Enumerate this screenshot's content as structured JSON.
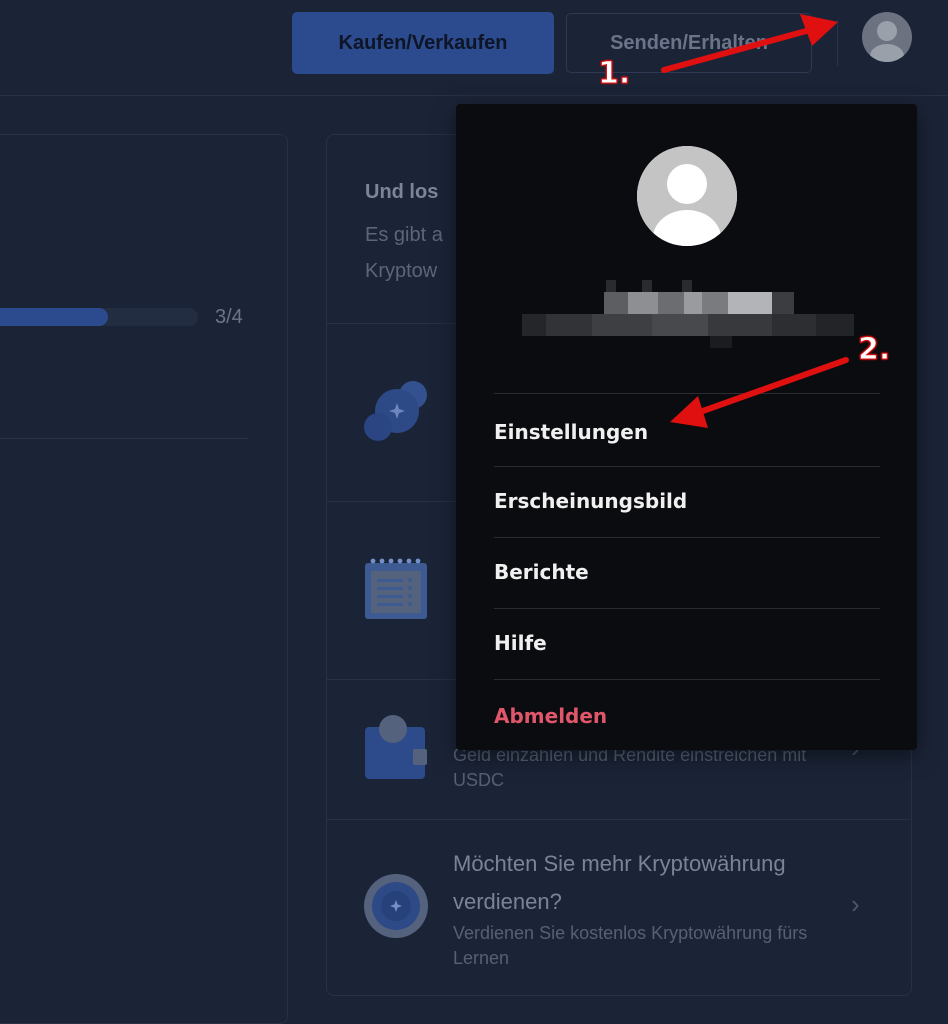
{
  "header": {
    "buy_sell_label": "Kaufen/Verkaufen",
    "send_receive_label": "Senden/Erhalten",
    "avatar_icon": "user-avatar-icon"
  },
  "left_panel": {
    "progress_value": 0.75,
    "progress_label": "3/4"
  },
  "right_panel": {
    "title": "Und los",
    "subtitle": "Es gibt a",
    "subtitle_line2": "Kryptow",
    "items": [
      {
        "icon": "crypto-circles-icon",
        "title": "",
        "description": ""
      },
      {
        "icon": "calendar-notepad-icon",
        "title": "",
        "description": ""
      },
      {
        "icon": "wallet-coin-icon",
        "title": "",
        "description": "Geld einzahlen und Rendite einstreichen mit USDC"
      },
      {
        "icon": "target-coin-icon",
        "title": "Möchten Sie mehr Kryptowährung verdienen?",
        "description": "Verdienen Sie kostenlos Kryptowährung fürs Lernen"
      }
    ]
  },
  "dropdown": {
    "avatar_icon": "user-avatar-icon",
    "menu": [
      {
        "label": "Einstellungen"
      },
      {
        "label": "Erscheinungsbild"
      },
      {
        "label": "Berichte"
      },
      {
        "label": "Hilfe"
      },
      {
        "label": "Abmelden"
      }
    ]
  },
  "annotations": {
    "step1": "1.",
    "step2": "2."
  },
  "colors": {
    "background": "#1b2437",
    "primary_button": "#2c4a8e",
    "dropdown_bg": "#0b0c0f",
    "logout": "#e0566a",
    "annotation": "#e01010"
  }
}
